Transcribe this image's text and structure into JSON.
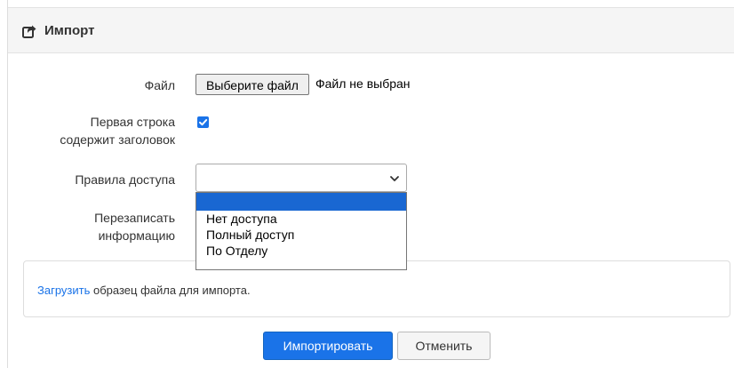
{
  "header": {
    "title": "Импорт",
    "icon": "share-square-icon"
  },
  "form": {
    "file": {
      "label": "Файл",
      "button_label": "Выберите файл",
      "status": "Файл не выбран"
    },
    "first_row_header": {
      "label_line1": "Первая строка",
      "label_line2": "содержит заголовок",
      "checked": true
    },
    "access_rules": {
      "label": "Правила доступа",
      "selected": "",
      "options": [
        "",
        "Нет доступа",
        "Полный доступ",
        "По Отделу"
      ]
    },
    "overwrite": {
      "label_line1": "Перезаписать",
      "label_line2": "информацию"
    }
  },
  "note": {
    "link_text": "Загрузить",
    "text": " образец файла для импорта."
  },
  "actions": {
    "import_label": "Импортировать",
    "cancel_label": "Отменить"
  },
  "colors": {
    "accent": "#1a73e8",
    "selected_option": "#1967d2"
  }
}
